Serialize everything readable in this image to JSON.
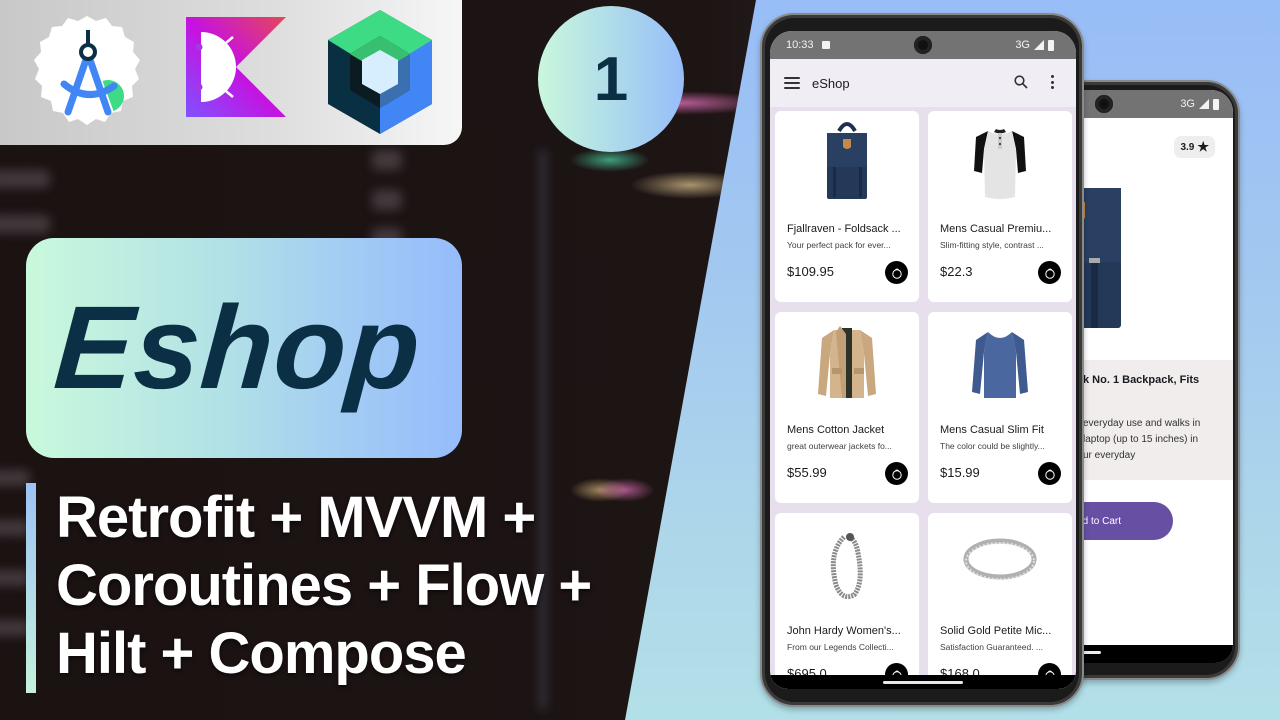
{
  "logos": [
    {
      "name": "Android Studio",
      "icon": "android-studio-icon"
    },
    {
      "name": "Kotlin for Android",
      "icon": "kotlin-icon"
    },
    {
      "name": "Jetpack Compose",
      "icon": "jetpack-compose-icon"
    }
  ],
  "episode_number": "1",
  "title": "Eshop",
  "subtitle_lines": [
    "Retrofit + MVVM +",
    "Coroutines + Flow +",
    "Hilt + Compose"
  ],
  "colors": {
    "title_text": "#0b3045",
    "gradient_start": "#c9f9dc",
    "gradient_end": "#96bcfb",
    "app_accent": "#6750a4",
    "appbar_bg": "#f1edf5",
    "grid_bg": "#e7e0ec"
  },
  "front_phone": {
    "status_bar": {
      "time": "10:33",
      "network": "3G"
    },
    "app_bar": {
      "title": "eShop",
      "menu_icon": "menu-icon",
      "search_icon": "search-icon",
      "more_icon": "more-vert-icon"
    },
    "products": [
      {
        "title": "Fjallraven - Foldsack ...",
        "description": "Your perfect pack for ever...",
        "price": "$109.95",
        "image": "backpack"
      },
      {
        "title": "Mens Casual Premiu...",
        "description": "Slim-fitting style, contrast ...",
        "price": "$22.3",
        "image": "raglan-tshirt"
      },
      {
        "title": "Mens Cotton Jacket",
        "description": "great outerwear jackets fo...",
        "price": "$55.99",
        "image": "jacket"
      },
      {
        "title": "Mens Casual Slim Fit",
        "description": "The color could be slightly...",
        "price": "$15.99",
        "image": "long-sleeve-tshirt"
      },
      {
        "title": "John Hardy Women's...",
        "description": "From our Legends Collecti...",
        "price": "$695.0",
        "image": "bracelet"
      },
      {
        "title": "Solid Gold Petite Mic...",
        "description": "Satisfaction Guaranteed. ...",
        "price": "$168.0",
        "image": "ring"
      }
    ]
  },
  "back_phone": {
    "status_bar": {
      "network": "3G"
    },
    "rating": "3.9",
    "product_title": "k No. 1 Backpack, Fits",
    "description_lines": [
      "everyday use and walks in",
      "laptop (up to 15 inches) in",
      "ur everyday"
    ],
    "add_to_cart_label": "ld to Cart"
  }
}
